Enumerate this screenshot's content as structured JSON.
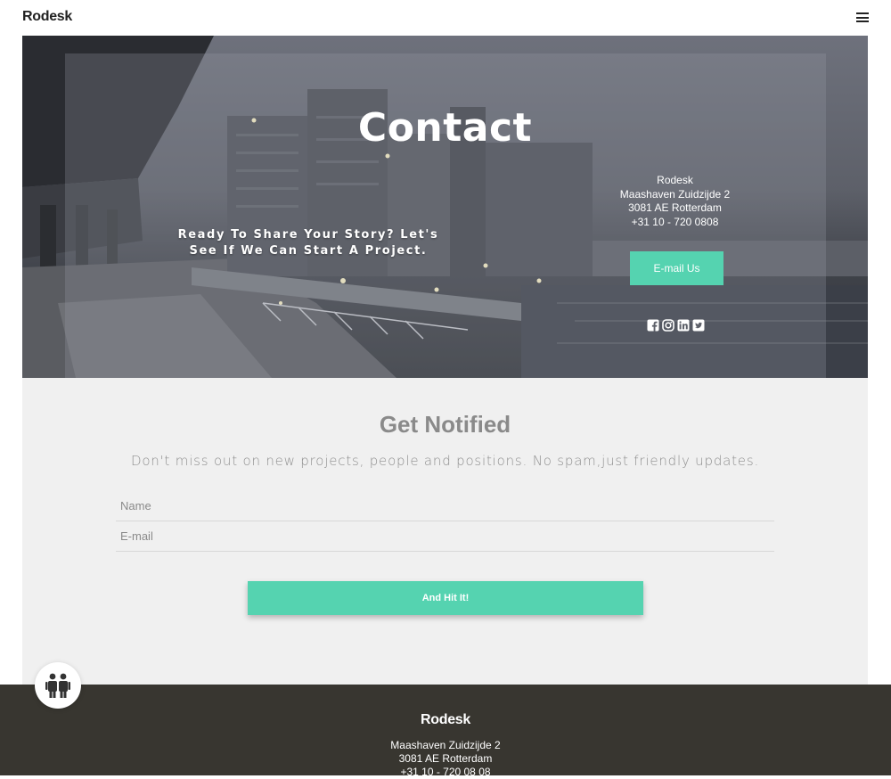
{
  "header": {
    "logo": "Rodesk",
    "menu_icon": "hamburger-menu-icon"
  },
  "hero": {
    "title": "Contact",
    "tagline": "Ready To Share Your Story? Let's See If We Can Start A Project.",
    "address": {
      "company": "Rodesk",
      "street": "Maashaven Zuidzijde 2",
      "city": "3081 AE Rotterdam",
      "phone": "+31 10 - 720 0808"
    },
    "email_button": "E-mail Us",
    "socials": [
      "facebook-icon",
      "instagram-icon",
      "linkedin-icon",
      "twitter-icon"
    ]
  },
  "notify": {
    "title": "Get Notified",
    "subtitle": "Don't miss out on new projects, people and positions. No spam,just friendly updates.",
    "name_placeholder": "Name",
    "email_placeholder": "E-mail",
    "submit_label": "And Hit It!"
  },
  "footer": {
    "logo": "Rodesk",
    "street": "Maashaven Zuidzijde 2",
    "city": "3081 AE Rotterdam",
    "phone": "+31 10 - 720 08 08"
  },
  "colors": {
    "accent": "#55d3b0",
    "footer_bg": "#383630",
    "section_bg": "#f0f0f0"
  }
}
